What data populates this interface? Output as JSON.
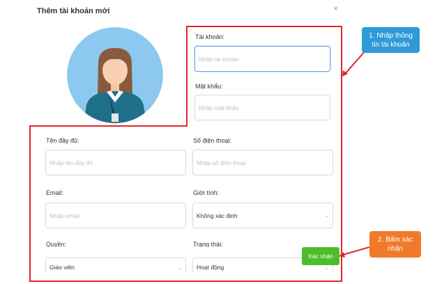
{
  "dialog": {
    "title": "Thêm tài khoản mới",
    "close_glyph": "×"
  },
  "form": {
    "username": {
      "label": "Tài khoản:",
      "placeholder": "Nhập tài khoản"
    },
    "password": {
      "label": "Mật khẩu:",
      "placeholder": "Nhập mật khẩu"
    },
    "fullname": {
      "label": "Tên đầy đủ:",
      "placeholder": "Nhập tên đầy đủ"
    },
    "phone": {
      "label": "Số điện thoại:",
      "placeholder": "Nhập số điện thoại"
    },
    "email": {
      "label": "Email:",
      "placeholder": "Nhập email"
    },
    "gender": {
      "label": "Giới tính:",
      "value": "Không xác định"
    },
    "role": {
      "label": "Quyền:",
      "value": "Giáo viên"
    },
    "status": {
      "label": "Trạng thái:",
      "value": "Hoạt động"
    },
    "submit_label": "Xác nhận"
  },
  "annotations": {
    "step1": "1. Nhập thông tin tài khoản",
    "step2": "2. Bấm xác nhận",
    "step1_color": "#2e9ad8",
    "step2_color": "#f07a2a",
    "highlight_color": "#e0252b"
  },
  "icons": {
    "avatar": "female-user-avatar-icon",
    "chevron": "chevron-down-icon",
    "close": "close-icon"
  }
}
